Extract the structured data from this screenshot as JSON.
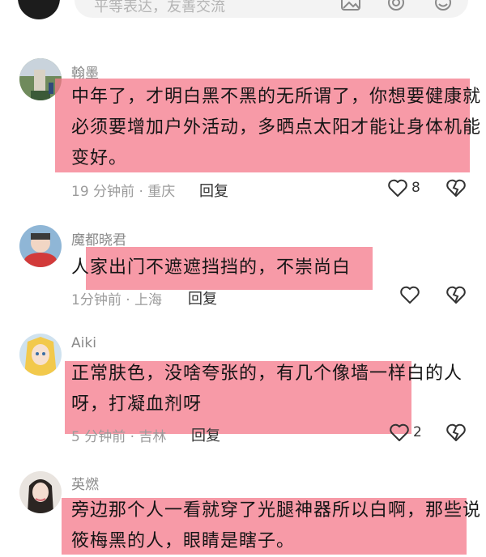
{
  "input": {
    "placeholder": "平等表达，友善交流"
  },
  "comments": [
    {
      "username": "翰墨",
      "text": "中年了，才明白黑不黑的无所谓了，你想要健康就\n必须要增加户外活动，多晒点太阳才能让身体机能\n变好。",
      "time_location": "19 分钟前 · 重庆",
      "reply": "回复",
      "likes": "8"
    },
    {
      "username": "魔都晓君",
      "text": "人家出门不遮遮挡挡的，不崇尚白",
      "time_location": "1分钟前 · 上海",
      "reply": "回复",
      "likes": ""
    },
    {
      "username": "Aiki",
      "text": "正常肤色，没啥夸张的，有几个像墙一样白的人\n呀，打凝血剂呀",
      "time_location": "5 分钟前 · 吉林",
      "reply": "回复",
      "likes": "2"
    },
    {
      "username": "英燃",
      "text": "旁边那个人一看就穿了光腿神器所以白啊，那些说\n筱梅黑的人，眼睛是瞎子。",
      "time_location": "",
      "reply": "",
      "likes": ""
    }
  ],
  "colors": {
    "highlight": "#f4788a",
    "username": "#8a8a8a",
    "meta": "#9b9b9b"
  },
  "icons": [
    "image-icon",
    "at-icon",
    "emoji-icon",
    "heart-icon",
    "dislike-heart-icon"
  ]
}
